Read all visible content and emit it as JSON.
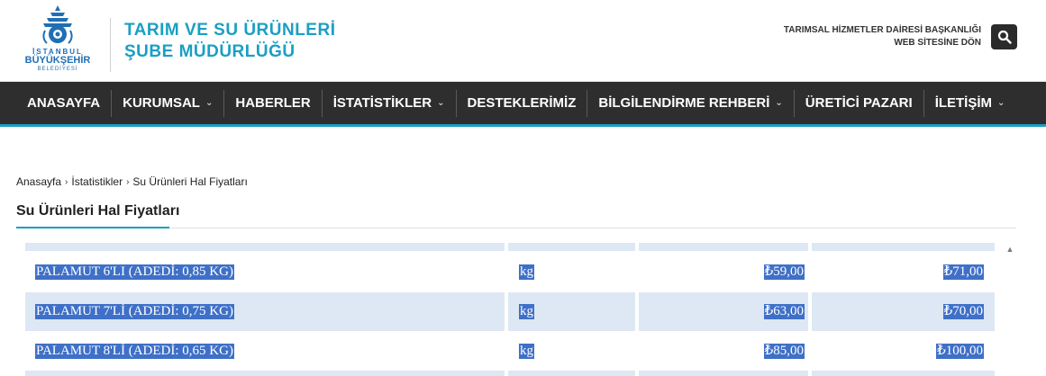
{
  "header": {
    "logo": {
      "line1": "İSTANBUL",
      "line2": "BÜYÜKŞEHİR",
      "line3": "BELEDİYESİ"
    },
    "dept_title_line1": "TARIM VE SU ÜRÜNLERİ",
    "dept_title_line2": "ŞUBE MÜDÜRLÜĞÜ",
    "back_link_line1": "TARIMSAL HİZMETLER DAİRESİ BAŞKANLIĞI",
    "back_link_line2": "WEB SİTESİNE DÖN",
    "search_icon": "search-icon"
  },
  "nav": {
    "items": [
      {
        "label": "ANASAYFA",
        "has_dropdown": false
      },
      {
        "label": "KURUMSAL",
        "has_dropdown": true
      },
      {
        "label": "HABERLER",
        "has_dropdown": false
      },
      {
        "label": "İSTATİSTİKLER",
        "has_dropdown": true
      },
      {
        "label": "DESTEKLERİMİZ",
        "has_dropdown": false
      },
      {
        "label": "BİLGİLENDİRME REHBERİ",
        "has_dropdown": true
      },
      {
        "label": "ÜRETİCİ PAZARI",
        "has_dropdown": false
      },
      {
        "label": "İLETİŞİM",
        "has_dropdown": true
      }
    ],
    "dropdown_glyph": "⌄"
  },
  "breadcrumb": {
    "items": [
      "Anasayfa",
      "İstatistikler",
      "Su Ürünleri Hal Fiyatları"
    ],
    "separator": "›"
  },
  "page_title": "Su Ürünleri Hal Fiyatları",
  "table": {
    "rows": [
      {
        "name": "PALAMUT 6'LI (ADEDİ: 0,85 KG)",
        "unit": "kg",
        "min_price": "₺59,00",
        "max_price": "₺71,00"
      },
      {
        "name": "PALAMUT 7'Lİ (ADEDİ: 0,75 KG)",
        "unit": "kg",
        "min_price": "₺63,00",
        "max_price": "₺70,00"
      },
      {
        "name": "PALAMUT 8'Lİ (ADEDİ: 0,65 KG)",
        "unit": "kg",
        "min_price": "₺85,00",
        "max_price": "₺100,00"
      }
    ]
  },
  "colors": {
    "accent": "#1a9fc2",
    "nav_bg": "#2e2e2e",
    "selection": "#3f70c8",
    "row_alt": "#dde8f4"
  }
}
